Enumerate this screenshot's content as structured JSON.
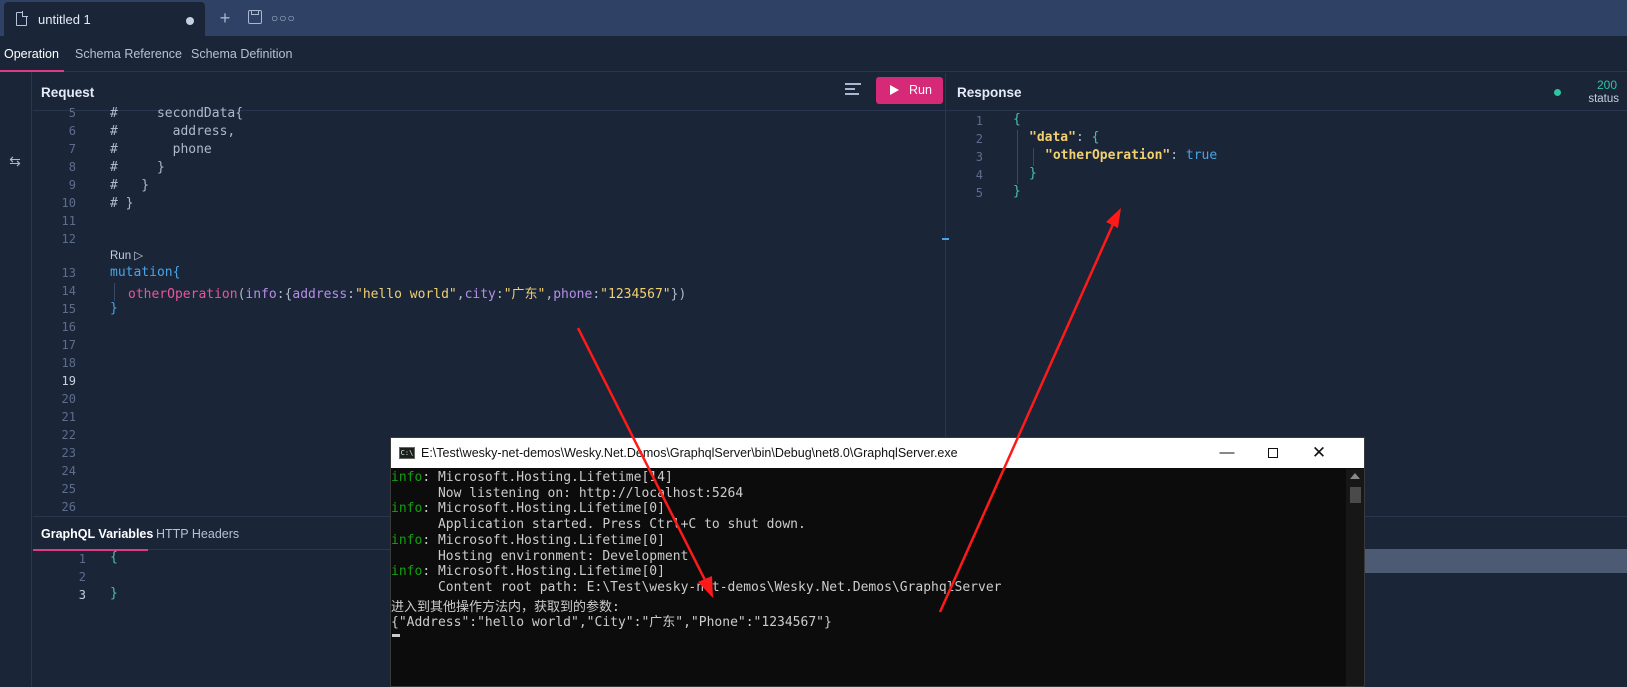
{
  "tabs": {
    "active_title": "untitled 1"
  },
  "subtabs": [
    "Operation",
    "Schema Reference",
    "Schema Definition"
  ],
  "request": {
    "title": "Request",
    "run_label": "Run",
    "codelens": "Run ▷",
    "line_numbers": [
      "5",
      "6",
      "7",
      "8",
      "9",
      "10",
      "11",
      "12",
      "13",
      "14",
      "15",
      "16",
      "17",
      "18",
      "19",
      "20",
      "21",
      "22",
      "23",
      "24",
      "25",
      "26"
    ],
    "code": {
      "l5": "#     secondData{",
      "l6": "#       address,",
      "l7": "#       phone",
      "l8": "#     }",
      "l9": "#   }",
      "l10": "# }",
      "l13": "mutation{",
      "l14_fn": "otherOperation",
      "l14_arg": "info",
      "l14_k1": "address",
      "l14_v1": "\"hello world\"",
      "l14_k2": "city",
      "l14_v2": "\"广东\"",
      "l14_k3": "phone",
      "l14_v3": "\"1234567\"",
      "l15": "}"
    }
  },
  "variables": {
    "tabs": [
      "GraphQL Variables",
      "HTTP Headers"
    ],
    "line_numbers": [
      "1",
      "2",
      "3"
    ],
    "lines": [
      "{",
      "",
      "}"
    ]
  },
  "response": {
    "title": "Response",
    "status_code": "200",
    "status_label": "status",
    "line_numbers": [
      "1",
      "2",
      "3",
      "4",
      "5"
    ],
    "json": {
      "open": "{",
      "data_key": "\"data\"",
      "op_key": "\"otherOperation\"",
      "op_value": "true",
      "close_inner": "}",
      "close": "}"
    }
  },
  "console": {
    "title": "E:\\Test\\wesky-net-demos\\Wesky.Net.Demos\\GraphqlServer\\bin\\Debug\\net8.0\\GraphqlServer.exe",
    "icon_text": "C:\\",
    "lines": [
      {
        "prefix": "info",
        "text": ": Microsoft.Hosting.Lifetime[14]"
      },
      {
        "prefix": "",
        "text": "      Now listening on: http://localhost:5264"
      },
      {
        "prefix": "info",
        "text": ": Microsoft.Hosting.Lifetime[0]"
      },
      {
        "prefix": "",
        "text": "      Application started. Press Ctrl+C to shut down."
      },
      {
        "prefix": "info",
        "text": ": Microsoft.Hosting.Lifetime[0]"
      },
      {
        "prefix": "",
        "text": "      Hosting environment: Development"
      },
      {
        "prefix": "info",
        "text": ": Microsoft.Hosting.Lifetime[0]"
      },
      {
        "prefix": "",
        "text": "      Content root path: E:\\Test\\wesky-net-demos\\Wesky.Net.Demos\\GraphqlServer"
      },
      {
        "prefix": "",
        "text": "进入到其他操作方法内，获取到的参数:"
      },
      {
        "prefix": "",
        "text": "{\"Address\":\"hello world\",\"City\":\"广东\",\"Phone\":\"1234567\"}"
      }
    ]
  },
  "colors": {
    "accent": "#e03a86",
    "run_button": "#d62a79",
    "status_ok": "#2ec4a0",
    "annotation_arrow": "#ff1a1a"
  }
}
